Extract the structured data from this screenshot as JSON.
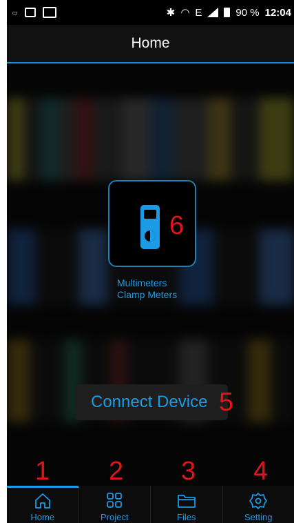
{
  "status_bar": {
    "network": "E",
    "battery": "90 %",
    "time": "12:04"
  },
  "app_bar": {
    "title": "Home"
  },
  "device": {
    "label_line1": "Multimeters",
    "label_line2": "Clamp Meters",
    "annotation": "6"
  },
  "connect": {
    "label": "Connect Device",
    "annotation": "5"
  },
  "nav": [
    {
      "label": "Home",
      "icon": "home-icon",
      "annotation": "1",
      "active": true
    },
    {
      "label": "Project",
      "icon": "grid-icon",
      "annotation": "2",
      "active": false
    },
    {
      "label": "Files",
      "icon": "folder-icon",
      "annotation": "3",
      "active": false
    },
    {
      "label": "Setting",
      "icon": "gear-icon",
      "annotation": "4",
      "active": false
    }
  ],
  "colors": {
    "accent": "#1b9be6",
    "annotation_red": "#e0141a",
    "background": "#000000"
  }
}
